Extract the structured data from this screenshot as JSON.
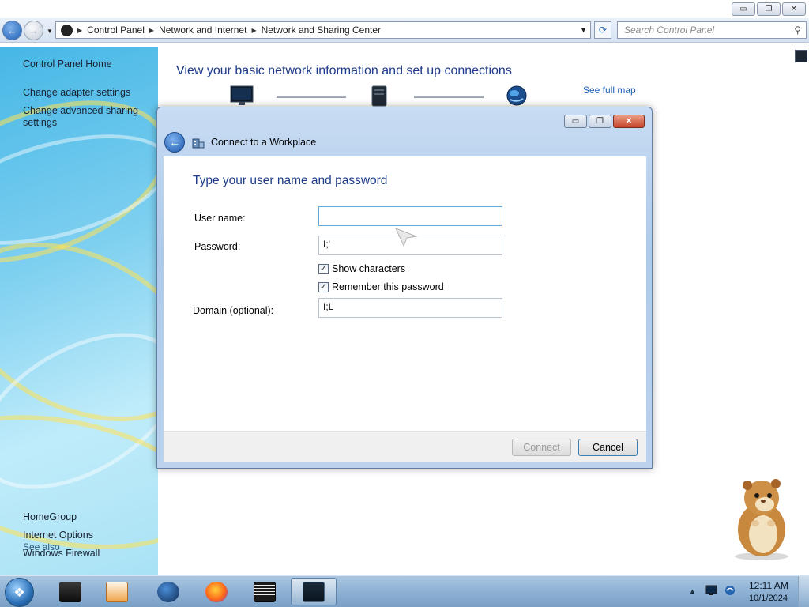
{
  "window": {
    "min_icon": "minimize-icon",
    "max_icon": "restore-icon",
    "close_icon": "close-icon",
    "min_glyph": "▭",
    "max_glyph": "❐",
    "close_glyph": "✕"
  },
  "address_bar": {
    "crumbs": [
      "Control Panel",
      "Network and Internet",
      "Network and Sharing Center"
    ],
    "search_placeholder": "Search Control Panel"
  },
  "sidebar": {
    "home": "Control Panel Home",
    "links": [
      "Change adapter settings",
      "Change advanced sharing settings"
    ],
    "see_also_title": "See also",
    "see_also": [
      "HomeGroup",
      "Internet Options",
      "Windows Firewall"
    ]
  },
  "main": {
    "title": "View your basic network information and set up connections",
    "see_full_map": "See full map"
  },
  "dialog": {
    "title": "Connect to a Workplace",
    "heading": "Type your user name and password",
    "username_label": "User name:",
    "username_value": "",
    "password_label": "Password:",
    "password_value": "I;'",
    "show_characters": "Show characters",
    "show_characters_checked": true,
    "remember_password": "Remember this password",
    "remember_password_checked": true,
    "domain_label": "Domain (optional):",
    "domain_value": "I;L",
    "connect_label": "Connect",
    "cancel_label": "Cancel"
  },
  "taskbar": {
    "time": "12:11 AM",
    "date": "10/1/2024"
  },
  "colors": {
    "link": "#1a5fb4",
    "heading": "#1e3a8a"
  }
}
